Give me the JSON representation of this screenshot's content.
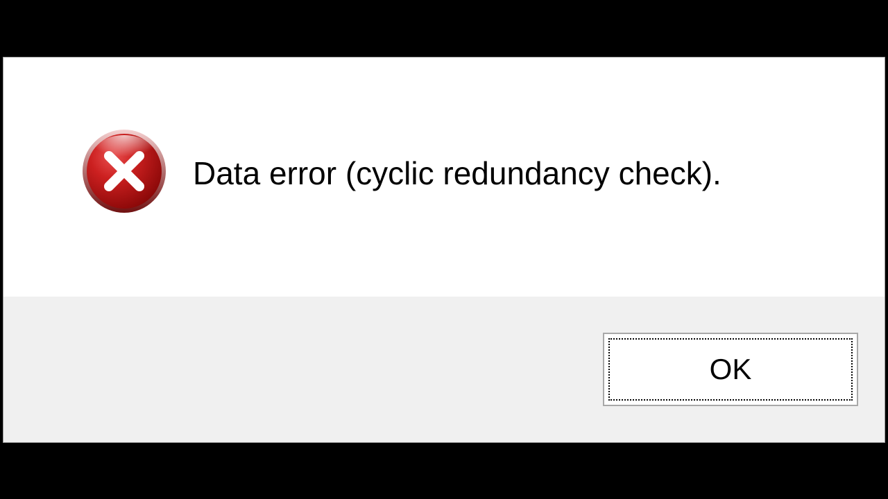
{
  "dialog": {
    "message": "Data error (cyclic redundancy check).",
    "ok_label": "OK"
  }
}
